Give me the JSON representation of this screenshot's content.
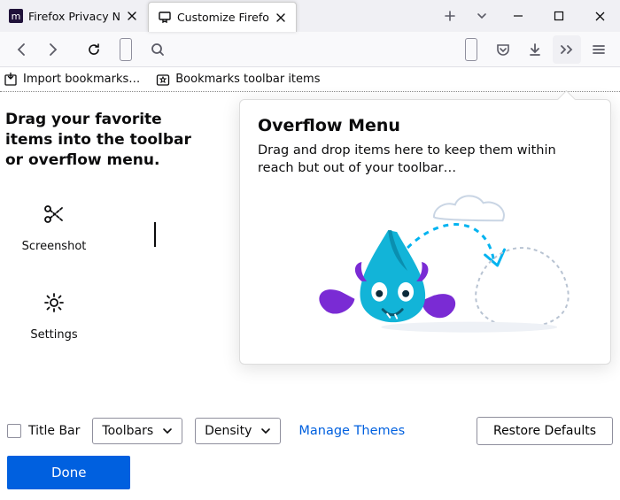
{
  "tabs": [
    {
      "label": "Firefox Privacy N",
      "active": false
    },
    {
      "label": "Customize Firefo",
      "active": true
    }
  ],
  "bookmarks_bar": {
    "import": "Import bookmarks…",
    "folder": "Bookmarks toolbar items"
  },
  "palette": {
    "heading": "Drag your favorite items into the toolbar or overflow menu.",
    "items": [
      {
        "label": "Screenshot"
      },
      {
        "label": "Settings"
      }
    ]
  },
  "overflow": {
    "title": "Overflow Menu",
    "desc": "Drag and drop items here to keep them within reach but out of your toolbar…"
  },
  "footer": {
    "titlebar_label": "Title Bar",
    "toolbars_label": "Toolbars",
    "density_label": "Density",
    "manage_themes": "Manage Themes",
    "restore": "Restore Defaults",
    "done": "Done"
  }
}
